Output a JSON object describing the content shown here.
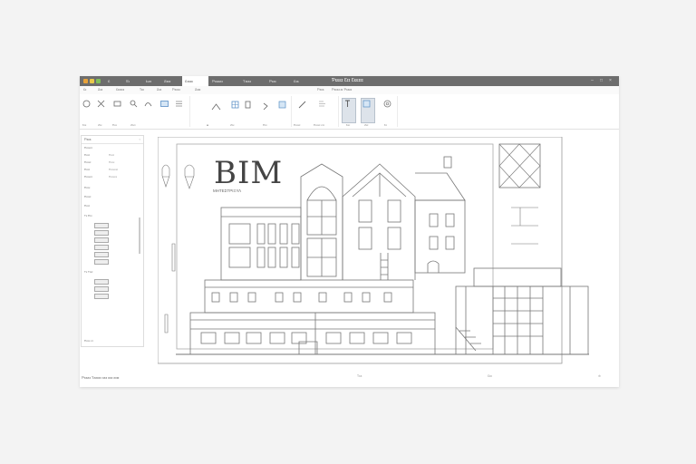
{
  "window": {
    "menu_tabs": [
      "Ɛ",
      "Ἐɩ",
      "Ьɪэ",
      "Ƨɪɛɪ",
      "Ɛɪɛɪɛ",
      "Ƥɛɛɛɛɪ",
      "Ƭɪɛɛɪ",
      "Ƥɪɛɪ",
      "Ɛɪɛ"
    ],
    "active_tab_index": 4,
    "document_title": "Ƥɛɛɛɪ Ɛɪɪ Ɛɛɛɪɪɪ"
  },
  "ribbon": {
    "labels": [
      "Ɛɪ",
      "Ƨɪɛ",
      "Ɛɪɛɪɛɪ",
      "Ƭɪɛ",
      "Ƨɪɛ",
      "Ƥɛɛɛɪ",
      "Ƨɪɛɪ",
      "Ƥɛɛɛ",
      "Ƥɛɛɛɪ ɛɪ Ƥɛɛɛɪ"
    ],
    "groups": [
      "Ɛɪɛ",
      "Ƨɪɛ",
      "Ƥɛɛ",
      "Ƨɪɛɪ",
      "ⴴ",
      "Ƨɪɛ",
      "Ƥɪɛ",
      "Ƥɛɛɛɪ",
      "Ƥɛɛɛɪ ɛɪɪ",
      "Ɛɛɪ",
      "Ƨɛɪ",
      "Ɛɪ"
    ]
  },
  "panel": {
    "title": "Ƥɛɛɛ",
    "rows": [
      {
        "label": "Ƥɛɛɛɛɪ",
        "value": ""
      },
      {
        "label": "Ƥɛɛɪ",
        "value": "Ƥɛɛɪ"
      },
      {
        "label": "Ƥɛɛɛɪ",
        "value": "Ƥɛɛɛ"
      },
      {
        "label": "Ƥɛɛɪ",
        "value": "Ƥɛɛɛɛɛɪ"
      },
      {
        "label": "Ƥɛɛɛɛɪ",
        "value": "Ƥɛɛɛɛɛ"
      },
      {
        "label": "Ƥɛɛɛ",
        "value": ""
      },
      {
        "label": "Ƥɛɛɛɪ",
        "value": ""
      },
      {
        "label": "Ƥɛɛɪ",
        "value": ""
      }
    ],
    "section_a": "Ƭɛ Ƥɪɛ",
    "section_b": "Ƭɛ Ƭɪɛɪ",
    "search": "Ƥɛɛɛ ɛɪ"
  },
  "status": {
    "left": "Ƥɛɛɛɪ Ƭɛɛɛɪɪ ɛɛɪ ɛɛɪ ɛɪɪɪ",
    "right_a": "Ƭɛɛ",
    "right_b": "Ɛɪɛ"
  },
  "drawing": {
    "title": "BIM",
    "subtitle": "ΜΗΤΕΣΤΡΙΞΥΛ"
  },
  "colors": {
    "titlebar": "#6d6d6d",
    "dot_orange": "#e8a23a",
    "dot_yellow": "#e8c84a",
    "dot_green": "#7fbf5a",
    "ribbon_icon_blue": "#5a8fc6",
    "line": "#777777"
  }
}
